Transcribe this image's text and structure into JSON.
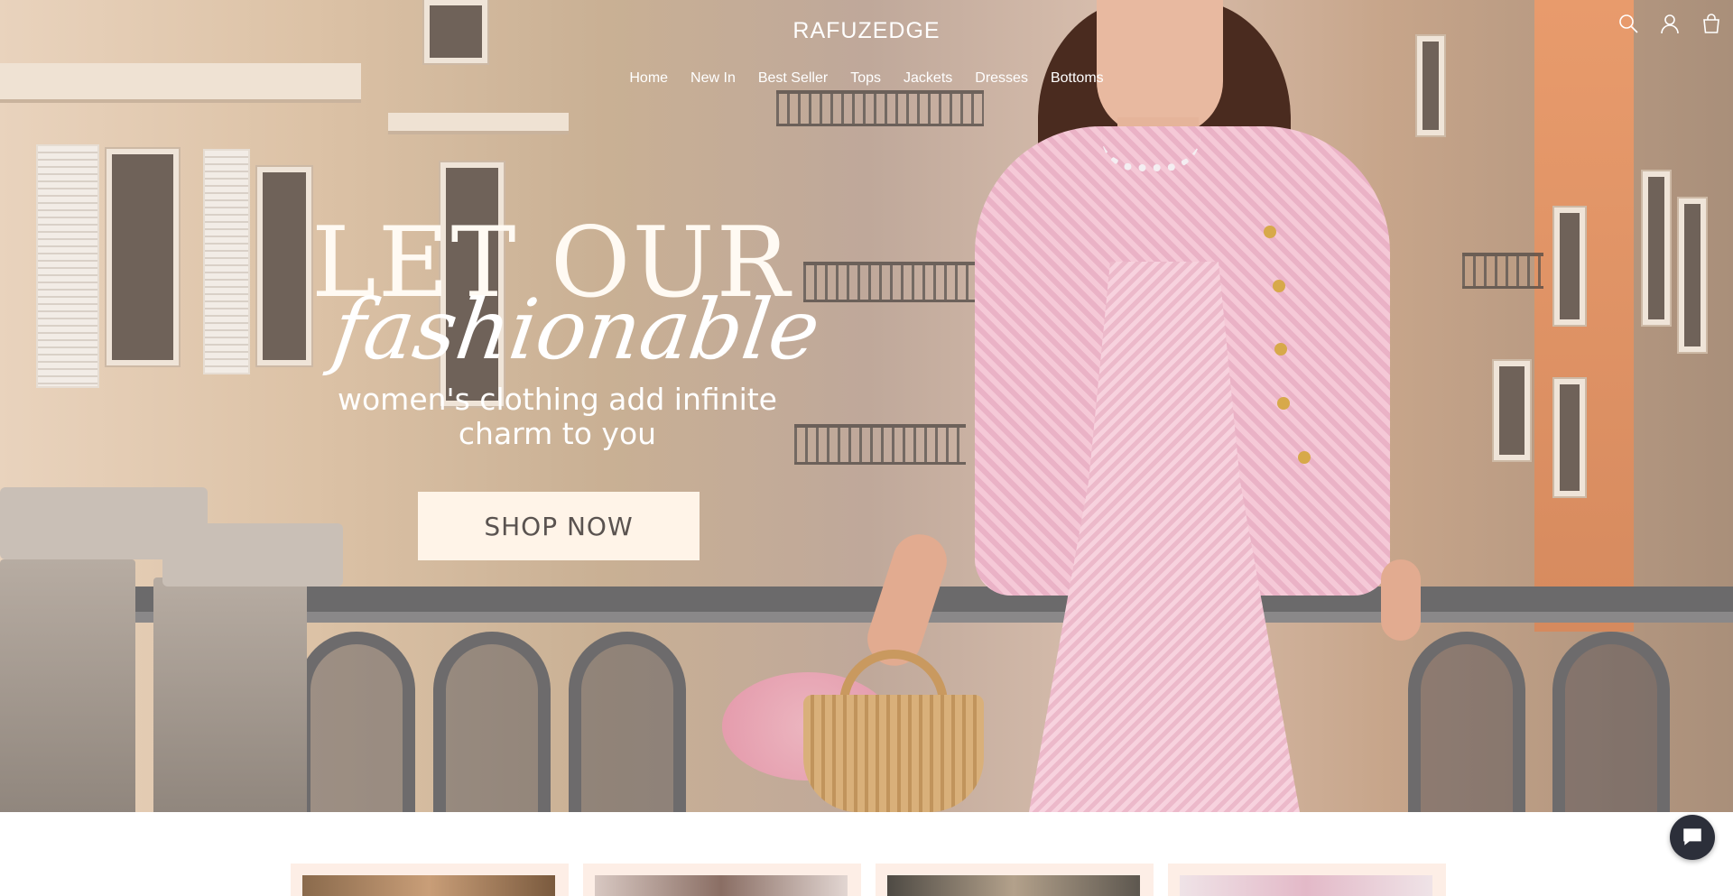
{
  "brand": "RAFUZEDGE",
  "nav": {
    "items": [
      {
        "label": "Home"
      },
      {
        "label": "New In"
      },
      {
        "label": "Best Seller"
      },
      {
        "label": "Tops"
      },
      {
        "label": "Jackets"
      },
      {
        "label": "Dresses"
      },
      {
        "label": "Bottoms"
      }
    ]
  },
  "header_icons": [
    "search-icon",
    "account-icon",
    "cart-icon"
  ],
  "hero": {
    "headline": "LET OUR",
    "script": "fashionable",
    "subtitle": "women's clothing add infinite charm to you",
    "cta_label": "SHOP NOW"
  },
  "chat": {
    "icon": "chat-bubble-icon"
  },
  "colors": {
    "cta_bg": "#fff4e8",
    "cta_text": "#5a5350",
    "chat_bg": "#2c2f3a",
    "card_bg": "#fdeee6"
  }
}
